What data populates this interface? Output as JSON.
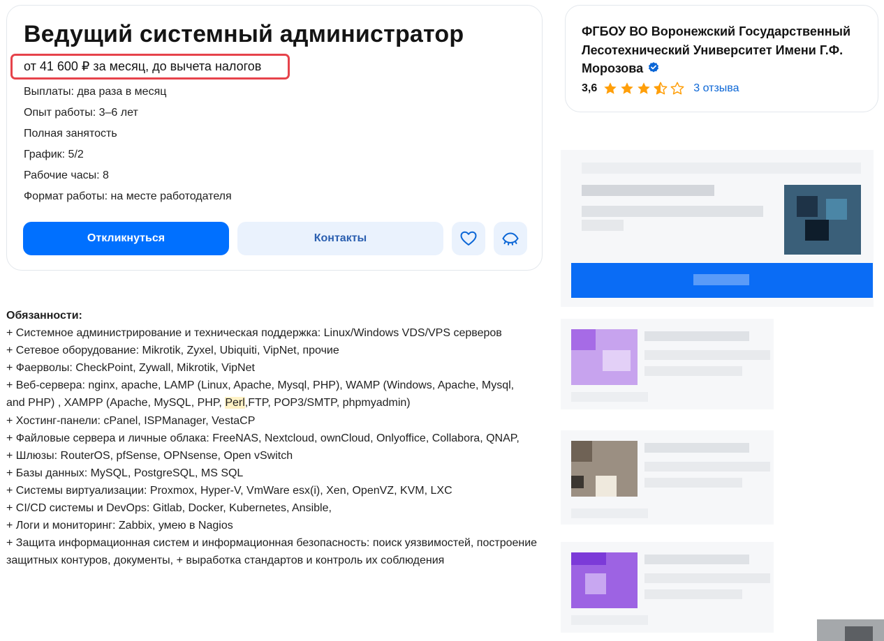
{
  "vacancy": {
    "title": "Ведущий системный администратор",
    "salary": "от 41 600 ₽ за месяц, до вычета налогов",
    "details": [
      "Выплаты: два раза в месяц",
      "Опыт работы: 3–6 лет",
      "Полная занятость",
      "График: 5/2",
      "Рабочие часы: 8",
      "Формат работы: на месте работодателя"
    ],
    "apply_label": "Откликнуться",
    "contacts_label": "Контакты",
    "favorite_icon": "heart-icon",
    "hide_icon": "eye-closed-icon"
  },
  "employer": {
    "name": "ФГБОУ ВО Воронежский Государственный Лесотехнический Университет Имени Г.Ф. Морозова",
    "rating": "3,6",
    "rating_stars": 3.5,
    "reviews_link": "3 отзыва"
  },
  "description": {
    "heading": "Обязанности:",
    "lines": [
      "+ Системное администрирование и техническая поддержка: Linux/Windows VDS/VPS серверов",
      "+ Сетевое оборудование: Mikrotik, Zyxel, Ubiquiti, VipNet, прочие",
      "+ Фаерволы: CheckPoint, Zywall, Mikrotik, VipNet",
      "+ Веб-сервера: nginx, apache, LAMP (Linux, Apache, Mysql, PHP), WAMP (Windows, Apache, Mysql,",
      "and PHP) , XAMPP (Apache, MySQL, PHP, ",
      "Perl",
      ",FTP, POP3/SMTP, phpmyadmin)",
      "+ Хостинг-панели: cPanel, ISPManager, VestaCP",
      "+ Файловые сервера и личные облака: FreeNAS, Nextcloud, ownCloud, Onlyoffice, Collabora, QNAP,",
      "+ Шлюзы: RouterOS, pfSense, OPNsense, Open vSwitch",
      "+ Базы данных: MySQL, PostgreSQL, MS SQL",
      "+ Системы виртуализации: Proxmox, Hyper-V, VmWare esx(i), Xen, OpenVZ, KVM, LXC",
      "+ CI/CD системы и DevOps: Gitlab, Docker, Kubernetes, Ansible,",
      "+ Логи и мониторинг: Zabbix, умею в Nagios",
      "+ Защита информационная систем и информационная безопасность: поиск уязвимостей, построение защитных контуров, документы, + выработка стандартов и контроль их соблюдения"
    ]
  },
  "colors": {
    "primary": "#0070ff",
    "secondary_bg": "#eaf2fd",
    "star": "#ff9f0a",
    "link": "#0b66d6",
    "highlight_box": "#e6434b",
    "verified": "#0b66d6"
  }
}
